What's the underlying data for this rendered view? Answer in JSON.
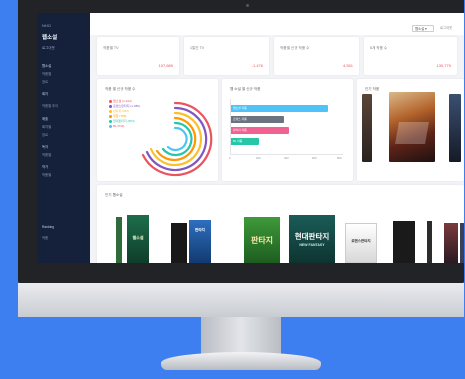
{
  "colors": {
    "background": "#3d7ff0",
    "sidebar": "#15203a",
    "accent_red": "#e8555e",
    "bar_blue": "#4fc3f7",
    "bar_gray": "#6b7280",
    "bar_pink": "#f06292",
    "bar_teal": "#26c6a8"
  },
  "sidebar": {
    "logo": "NHO",
    "title": "웹소설",
    "subtitle": "로그아웃",
    "items": [
      "웹소설",
      "작품별",
      "장르",
      "회차",
      "",
      "작품별 추이",
      "",
      "매출",
      "회차별",
      "장르",
      "",
      "독자",
      "작품별",
      "",
      "작가",
      "작품별",
      "",
      "Ranking",
      "작품"
    ]
  },
  "topbar": {
    "select_value": "웹소설 ▾",
    "link": "로그아웃"
  },
  "stats": [
    {
      "label": "작품별 TV",
      "value": "107,689"
    },
    {
      "label": "1일간 TV",
      "value": "-1,476"
    },
    {
      "label": "작품별 신규 작품 수",
      "value": "4,551"
    },
    {
      "label": "6개 작품 수",
      "value": "130,779"
    }
  ],
  "donut": {
    "title": "작품 별 신규 작품 수",
    "legend": [
      {
        "label": "웹소설 (1,234)",
        "color": "#e8555e"
      },
      {
        "label": "로맨스판타지 (1,089)",
        "color": "#7e57c2"
      },
      {
        "label": "판타지 (987)",
        "color": "#fbc02d"
      },
      {
        "label": "무협 (765)",
        "color": "#ff9800"
      },
      {
        "label": "현대판타지 (654)",
        "color": "#26c6a8"
      },
      {
        "label": "BL (543)",
        "color": "#4fc3f7"
      }
    ]
  },
  "bars": {
    "title": "웹 소설 별 신규 작품",
    "items": [
      {
        "label": "웹소설 작품",
        "value": 0.87,
        "color": "#4fc3f7"
      },
      {
        "label": "로맨스 작품",
        "value": 0.47,
        "color": "#6b7280"
      },
      {
        "label": "판타지 작품",
        "value": 0.52,
        "color": "#f06292"
      },
      {
        "label": "BL 작품",
        "value": 0.25,
        "color": "#26c6a8"
      }
    ],
    "ticks": [
      "0",
      "200",
      "400",
      "600",
      "800"
    ]
  },
  "posters": {
    "title": "인기 작품"
  },
  "books": {
    "title": "인기 웹소설",
    "covers": [
      {
        "text": "웹소설",
        "style": "green"
      },
      {
        "text": "",
        "style": "dark"
      },
      {
        "text": "판타지",
        "style": "blue"
      },
      {
        "text": "판타지",
        "style": "green"
      },
      {
        "text": "현대판타지",
        "style": "teal",
        "sub": "NEW FANTASY"
      },
      {
        "text": "로맨스판타지",
        "style": "white"
      },
      {
        "text": "",
        "style": "dark"
      }
    ]
  }
}
